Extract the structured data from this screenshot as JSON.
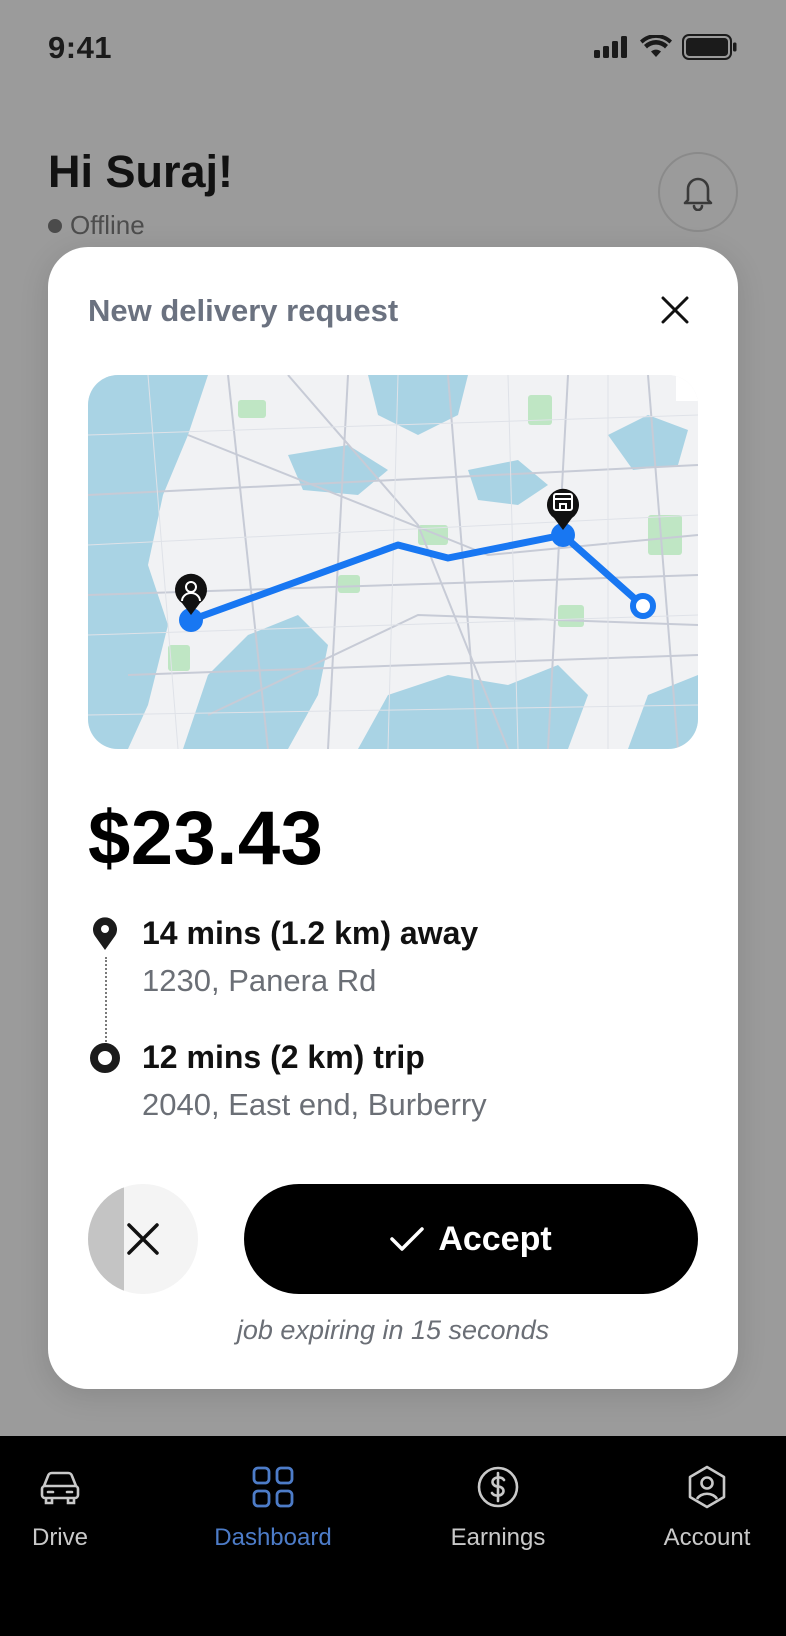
{
  "status_bar": {
    "time": "9:41"
  },
  "header": {
    "greeting": "Hi Suraj!",
    "presence": "Offline"
  },
  "request": {
    "title": "New delivery request",
    "price": "$23.43",
    "pickup": {
      "eta": "14 mins (1.2 km) away",
      "address": "1230, Panera Rd"
    },
    "dropoff": {
      "eta": "12 mins (2 km) trip",
      "address": "2040, East end, Burberry"
    },
    "accept_label": "Accept",
    "expiry_text": "job expiring in 15 seconds",
    "decline_timer_progress": 0.33
  },
  "tabs": [
    {
      "label": "Drive",
      "icon": "car-icon",
      "active": false
    },
    {
      "label": "Dashboard",
      "icon": "grid-icon",
      "active": true
    },
    {
      "label": "Earnings",
      "icon": "dollar-circle-icon",
      "active": false
    },
    {
      "label": "Account",
      "icon": "user-hexagon-icon",
      "active": false
    }
  ],
  "colors": {
    "route": "#1877f2",
    "active_tab": "#4d7cc8",
    "inactive_tab": "#c9c9c9",
    "accept_bg": "#000000"
  }
}
